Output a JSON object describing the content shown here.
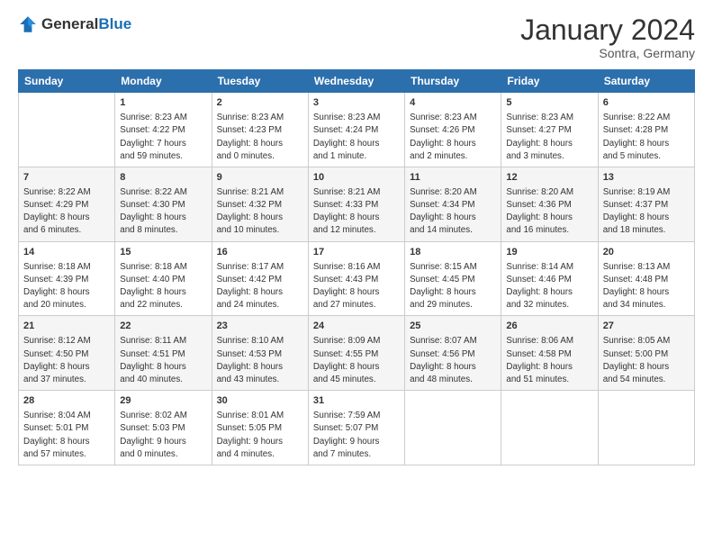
{
  "header": {
    "logo": {
      "general": "General",
      "blue": "Blue"
    },
    "title": "January 2024",
    "location": "Sontra, Germany"
  },
  "calendar": {
    "days_of_week": [
      "Sunday",
      "Monday",
      "Tuesday",
      "Wednesday",
      "Thursday",
      "Friday",
      "Saturday"
    ],
    "weeks": [
      [
        {
          "day": "",
          "info": ""
        },
        {
          "day": "1",
          "info": "Sunrise: 8:23 AM\nSunset: 4:22 PM\nDaylight: 7 hours\nand 59 minutes."
        },
        {
          "day": "2",
          "info": "Sunrise: 8:23 AM\nSunset: 4:23 PM\nDaylight: 8 hours\nand 0 minutes."
        },
        {
          "day": "3",
          "info": "Sunrise: 8:23 AM\nSunset: 4:24 PM\nDaylight: 8 hours\nand 1 minute."
        },
        {
          "day": "4",
          "info": "Sunrise: 8:23 AM\nSunset: 4:26 PM\nDaylight: 8 hours\nand 2 minutes."
        },
        {
          "day": "5",
          "info": "Sunrise: 8:23 AM\nSunset: 4:27 PM\nDaylight: 8 hours\nand 3 minutes."
        },
        {
          "day": "6",
          "info": "Sunrise: 8:22 AM\nSunset: 4:28 PM\nDaylight: 8 hours\nand 5 minutes."
        }
      ],
      [
        {
          "day": "7",
          "info": "Sunrise: 8:22 AM\nSunset: 4:29 PM\nDaylight: 8 hours\nand 6 minutes."
        },
        {
          "day": "8",
          "info": "Sunrise: 8:22 AM\nSunset: 4:30 PM\nDaylight: 8 hours\nand 8 minutes."
        },
        {
          "day": "9",
          "info": "Sunrise: 8:21 AM\nSunset: 4:32 PM\nDaylight: 8 hours\nand 10 minutes."
        },
        {
          "day": "10",
          "info": "Sunrise: 8:21 AM\nSunset: 4:33 PM\nDaylight: 8 hours\nand 12 minutes."
        },
        {
          "day": "11",
          "info": "Sunrise: 8:20 AM\nSunset: 4:34 PM\nDaylight: 8 hours\nand 14 minutes."
        },
        {
          "day": "12",
          "info": "Sunrise: 8:20 AM\nSunset: 4:36 PM\nDaylight: 8 hours\nand 16 minutes."
        },
        {
          "day": "13",
          "info": "Sunrise: 8:19 AM\nSunset: 4:37 PM\nDaylight: 8 hours\nand 18 minutes."
        }
      ],
      [
        {
          "day": "14",
          "info": "Sunrise: 8:18 AM\nSunset: 4:39 PM\nDaylight: 8 hours\nand 20 minutes."
        },
        {
          "day": "15",
          "info": "Sunrise: 8:18 AM\nSunset: 4:40 PM\nDaylight: 8 hours\nand 22 minutes."
        },
        {
          "day": "16",
          "info": "Sunrise: 8:17 AM\nSunset: 4:42 PM\nDaylight: 8 hours\nand 24 minutes."
        },
        {
          "day": "17",
          "info": "Sunrise: 8:16 AM\nSunset: 4:43 PM\nDaylight: 8 hours\nand 27 minutes."
        },
        {
          "day": "18",
          "info": "Sunrise: 8:15 AM\nSunset: 4:45 PM\nDaylight: 8 hours\nand 29 minutes."
        },
        {
          "day": "19",
          "info": "Sunrise: 8:14 AM\nSunset: 4:46 PM\nDaylight: 8 hours\nand 32 minutes."
        },
        {
          "day": "20",
          "info": "Sunrise: 8:13 AM\nSunset: 4:48 PM\nDaylight: 8 hours\nand 34 minutes."
        }
      ],
      [
        {
          "day": "21",
          "info": "Sunrise: 8:12 AM\nSunset: 4:50 PM\nDaylight: 8 hours\nand 37 minutes."
        },
        {
          "day": "22",
          "info": "Sunrise: 8:11 AM\nSunset: 4:51 PM\nDaylight: 8 hours\nand 40 minutes."
        },
        {
          "day": "23",
          "info": "Sunrise: 8:10 AM\nSunset: 4:53 PM\nDaylight: 8 hours\nand 43 minutes."
        },
        {
          "day": "24",
          "info": "Sunrise: 8:09 AM\nSunset: 4:55 PM\nDaylight: 8 hours\nand 45 minutes."
        },
        {
          "day": "25",
          "info": "Sunrise: 8:07 AM\nSunset: 4:56 PM\nDaylight: 8 hours\nand 48 minutes."
        },
        {
          "day": "26",
          "info": "Sunrise: 8:06 AM\nSunset: 4:58 PM\nDaylight: 8 hours\nand 51 minutes."
        },
        {
          "day": "27",
          "info": "Sunrise: 8:05 AM\nSunset: 5:00 PM\nDaylight: 8 hours\nand 54 minutes."
        }
      ],
      [
        {
          "day": "28",
          "info": "Sunrise: 8:04 AM\nSunset: 5:01 PM\nDaylight: 8 hours\nand 57 minutes."
        },
        {
          "day": "29",
          "info": "Sunrise: 8:02 AM\nSunset: 5:03 PM\nDaylight: 9 hours\nand 0 minutes."
        },
        {
          "day": "30",
          "info": "Sunrise: 8:01 AM\nSunset: 5:05 PM\nDaylight: 9 hours\nand 4 minutes."
        },
        {
          "day": "31",
          "info": "Sunrise: 7:59 AM\nSunset: 5:07 PM\nDaylight: 9 hours\nand 7 minutes."
        },
        {
          "day": "",
          "info": ""
        },
        {
          "day": "",
          "info": ""
        },
        {
          "day": "",
          "info": ""
        }
      ]
    ]
  }
}
